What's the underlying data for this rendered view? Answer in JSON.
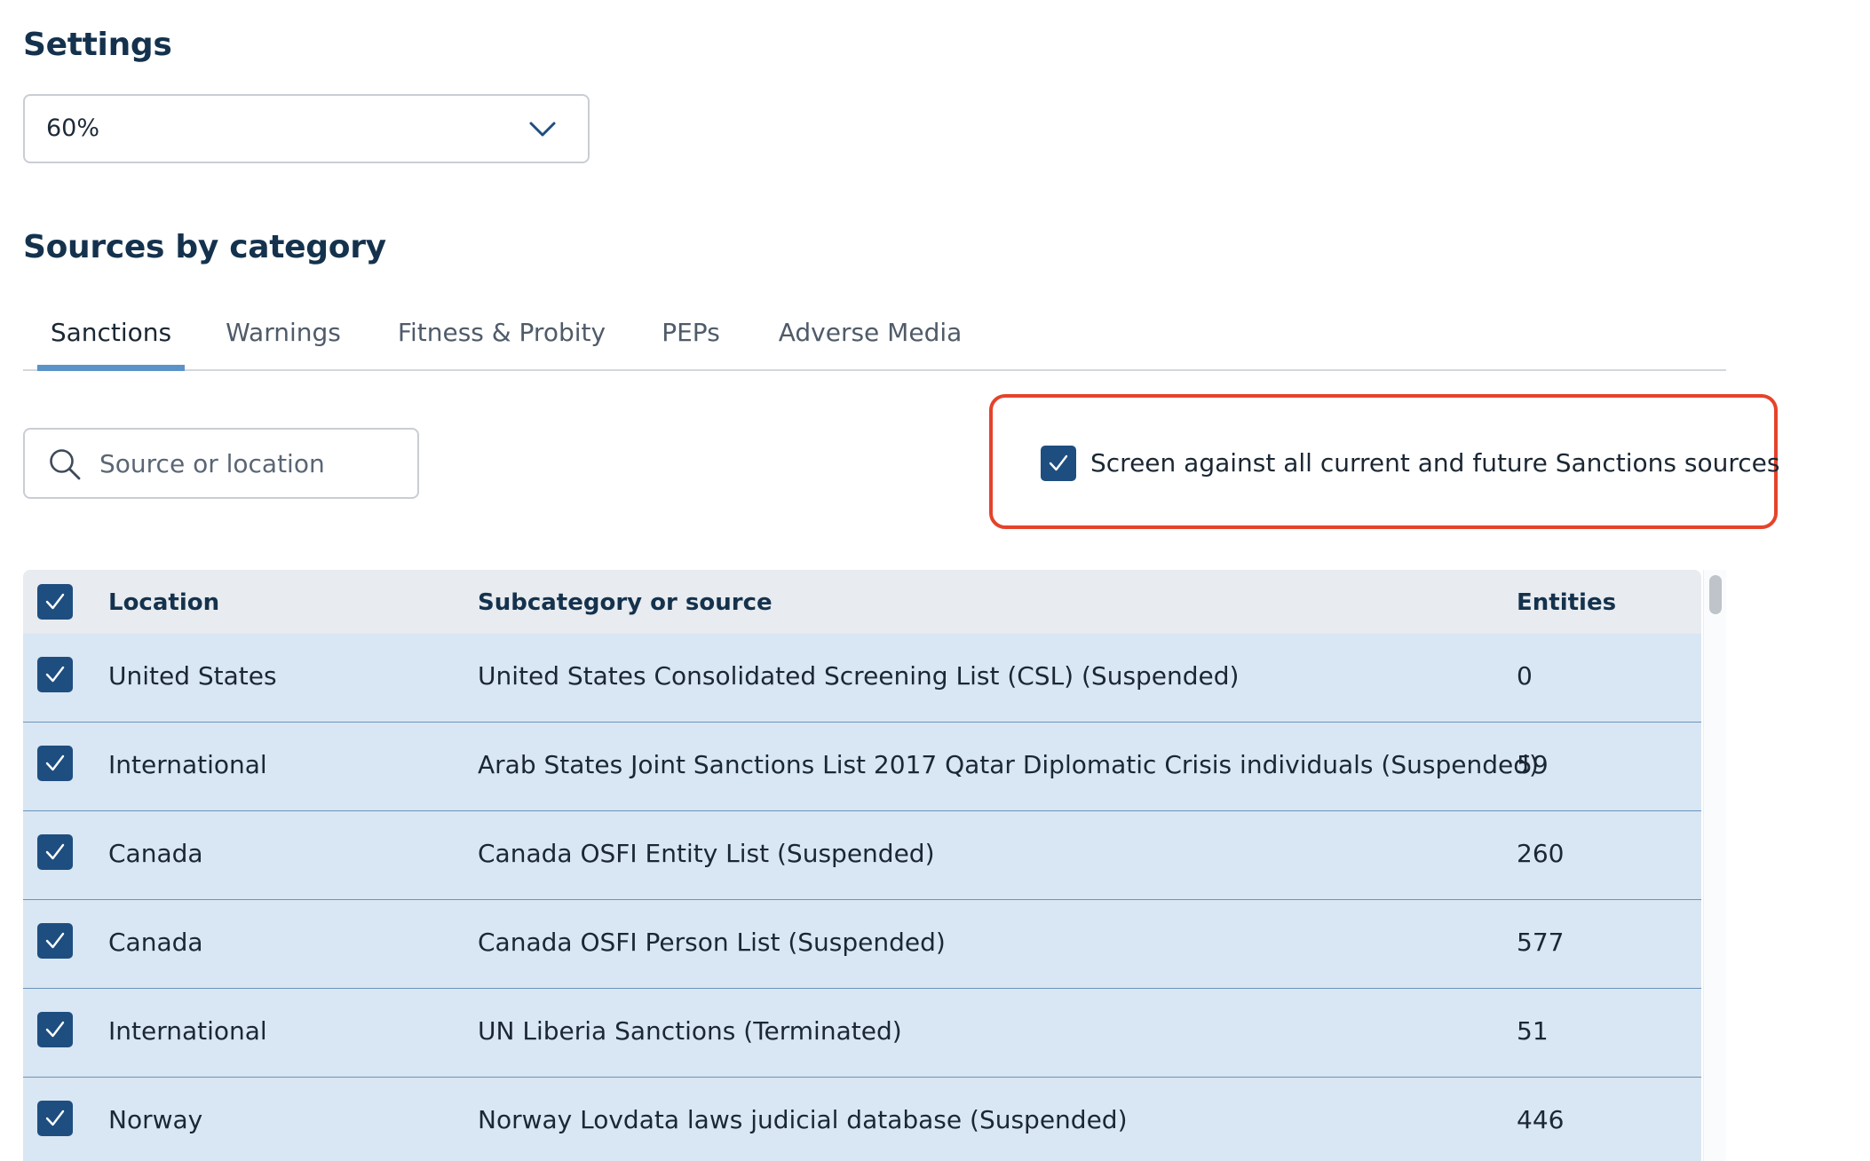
{
  "settings": {
    "title": "Settings",
    "threshold_select": {
      "value": "60%"
    }
  },
  "sources": {
    "title": "Sources by category",
    "tabs": [
      {
        "label": "Sanctions",
        "active": true
      },
      {
        "label": "Warnings",
        "active": false
      },
      {
        "label": "Fitness & Probity",
        "active": false
      },
      {
        "label": "PEPs",
        "active": false
      },
      {
        "label": "Adverse Media",
        "active": false
      }
    ],
    "search": {
      "placeholder": "Source or location",
      "value": ""
    },
    "screen_all": {
      "label": "Screen against all current and future Sanctions sources",
      "checked": true
    },
    "table": {
      "columns": {
        "location": "Location",
        "source": "Subcategory or source",
        "entities": "Entities"
      },
      "select_all_checked": true,
      "rows": [
        {
          "location": "United States",
          "source": "United States Consolidated Screening List (CSL) (Suspended)",
          "entities": "0",
          "checked": true
        },
        {
          "location": "International",
          "source": "Arab States Joint Sanctions List 2017 Qatar Diplomatic Crisis individuals (Suspended)",
          "entities": "59",
          "checked": true
        },
        {
          "location": "Canada",
          "source": "Canada OSFI Entity List (Suspended)",
          "entities": "260",
          "checked": true
        },
        {
          "location": "Canada",
          "source": "Canada OSFI Person List (Suspended)",
          "entities": "577",
          "checked": true
        },
        {
          "location": "International",
          "source": "UN Liberia Sanctions (Terminated)",
          "entities": "51",
          "checked": true
        },
        {
          "location": "Norway",
          "source": "Norway Lovdata laws judicial database (Suspended)",
          "entities": "446",
          "checked": true
        }
      ]
    }
  },
  "colors": {
    "heading": "#14324d",
    "checkbox": "#1e4e80",
    "tab_indicator": "#5b93c9",
    "highlight_border": "#e5432b",
    "row_background": "#d9e6f3",
    "header_background": "#e8ebef"
  },
  "icons": {
    "dropdown": "chevron-down-icon",
    "search": "search-icon",
    "checkbox": "checkmark-icon"
  }
}
